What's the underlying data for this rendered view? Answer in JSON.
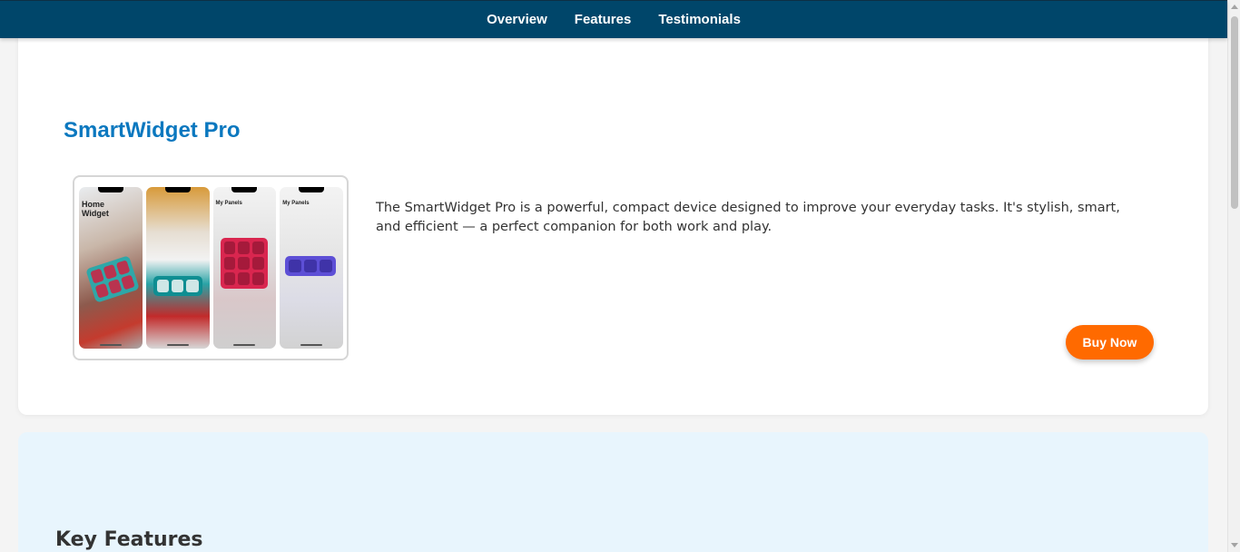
{
  "nav": {
    "items": [
      {
        "label": "Overview"
      },
      {
        "label": "Features"
      },
      {
        "label": "Testimonials"
      }
    ]
  },
  "product": {
    "title": "SmartWidget Pro",
    "description": "The SmartWidget Pro is a powerful, compact device designed to improve your everyday tasks. It's stylish, smart, and efficient — a perfect companion for both work and play.",
    "buy_label": "Buy Now",
    "image": {
      "screens": [
        {
          "title": "Home Widget"
        },
        {
          "title": ""
        },
        {
          "title": "My Panels"
        },
        {
          "title": "My Panels"
        }
      ]
    }
  },
  "features": {
    "title": "Key Features"
  },
  "colors": {
    "nav_bg": "#00466a",
    "title": "#0b78bf",
    "accent": "#ff6a00",
    "features_bg": "#e8f5fd"
  }
}
